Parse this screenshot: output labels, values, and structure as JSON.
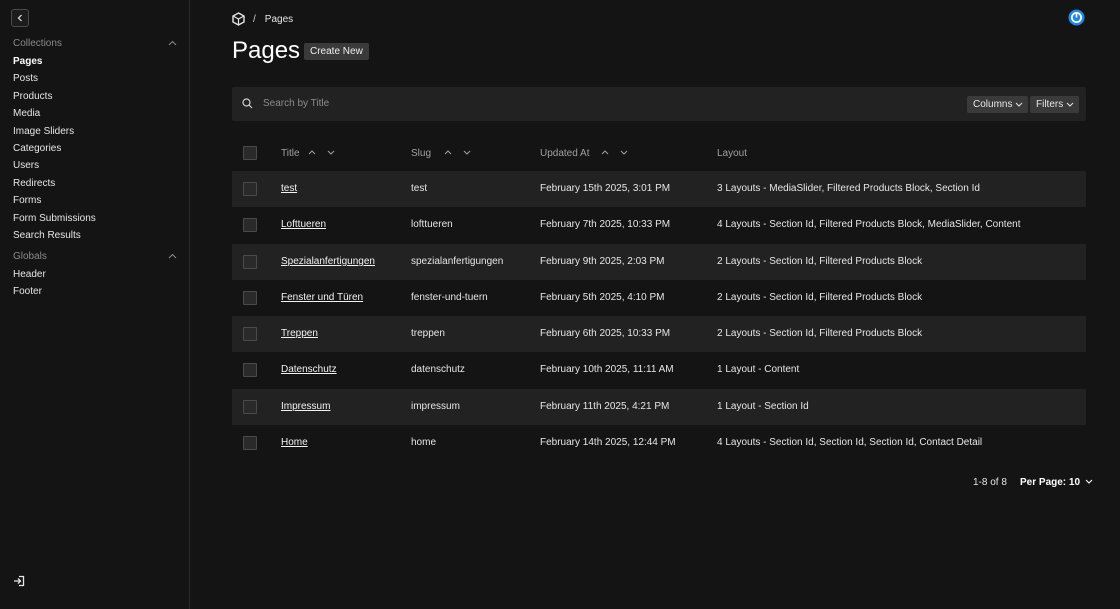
{
  "sidebar": {
    "collections_label": "Collections",
    "collections": [
      "Pages",
      "Posts",
      "Products",
      "Media",
      "Image Sliders",
      "Categories",
      "Users",
      "Redirects",
      "Forms",
      "Form Submissions",
      "Search Results"
    ],
    "active": "Pages",
    "globals_label": "Globals",
    "globals": [
      "Header",
      "Footer"
    ]
  },
  "breadcrumb": {
    "separator": "/",
    "current": "Pages"
  },
  "header": {
    "title": "Pages",
    "create_label": "Create New"
  },
  "search": {
    "placeholder": "Search by Title",
    "columns_label": "Columns",
    "filters_label": "Filters"
  },
  "table": {
    "columns": [
      "Title",
      "Slug",
      "Updated At",
      "Layout"
    ],
    "rows": [
      [
        "test",
        "test",
        "February 15th 2025, 3:01 PM",
        "3 Layouts - MediaSlider, Filtered Products Block, Section Id"
      ],
      [
        "Lofttueren",
        "lofttueren",
        "February 7th 2025, 10:33 PM",
        "4 Layouts - Section Id, Filtered Products Block, MediaSlider, Content"
      ],
      [
        "Spezialanfertigungen",
        "spezialanfertigungen",
        "February 9th 2025, 2:03 PM",
        "2 Layouts - Section Id, Filtered Products Block"
      ],
      [
        "Fenster und Türen",
        "fenster-und-tuern",
        "February 5th 2025, 4:10 PM",
        "2 Layouts - Section Id, Filtered Products Block"
      ],
      [
        "Treppen",
        "treppen",
        "February 6th 2025, 10:33 PM",
        "2 Layouts - Section Id, Filtered Products Block"
      ],
      [
        "Datenschutz",
        "datenschutz",
        "February 10th 2025, 11:11 AM",
        "1 Layout - Content"
      ],
      [
        "Impressum",
        "impressum",
        "February 11th 2025, 4:21 PM",
        "1 Layout - Section Id"
      ],
      [
        "Home",
        "home",
        "February 14th 2025, 12:44 PM",
        "4 Layouts - Section Id, Section Id, Section Id, Contact Detail"
      ]
    ]
  },
  "pagination": {
    "range": "1-8 of 8",
    "per_page": "Per Page: 10"
  },
  "colors": {
    "background": "#141414",
    "row_alt": "#222222",
    "accent": "#1e88e5"
  }
}
